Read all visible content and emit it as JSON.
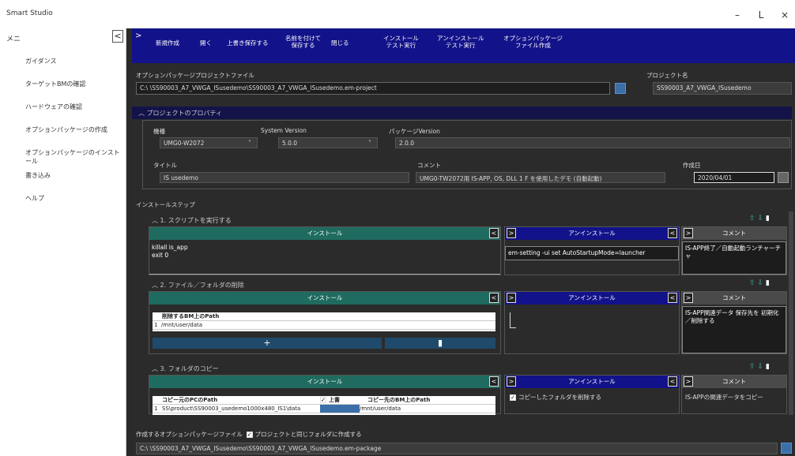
{
  "window": {
    "title": "Smart Studio",
    "minimize": "–",
    "maximize": "L",
    "close": "×"
  },
  "sidebar": {
    "menu_label": "メニ",
    "collapse": "<",
    "items": [
      "ガイダンス",
      "ターゲットBMの確認",
      "ハードウェアの確認",
      "オプションパッケージの作成",
      "オプションパッケージのインストール",
      "書き込み",
      "ヘルプ"
    ]
  },
  "toolbar": {
    "expand": ">",
    "buttons": [
      "新規作成",
      "開く",
      "上書き保存する",
      "名前を付けて\n保存する",
      "閉じる",
      "インストール\nテスト実行",
      "アンインストール\nテスト実行",
      "オプションパッケージ\nファイル作成"
    ]
  },
  "project": {
    "file_label": "オプションパッケージプロジェクトファイル",
    "file_path": "C:\\                                                              \\SS90003_A7_VWGA_ISusedemo\\SS90003_A7_VWGA_ISusedemo.em-project",
    "name_label": "プロジェクト名",
    "name_value": "SS90003_A7_VWGA_ISusedemo"
  },
  "properties": {
    "header": "プロジェクトのプロパティ",
    "model_label": "機種",
    "model_value": "UMG0-W2072",
    "sysver_label": "System Version",
    "sysver_value": "5.0.0",
    "pkgver_label": "パッケージVersion",
    "pkgver_value": "2.0.0",
    "title_label": "タイトル",
    "title_value": "IS usedemo",
    "comment_label": "コメント",
    "comment_value": "UMG0-TW2072用 IS-APP, OS, DLL 1 F を使用したデモ (自動起動)",
    "date_label": "作成日",
    "date_value": "2020/04/01"
  },
  "steps": {
    "header": "インストールステップ",
    "step1": {
      "title": "1. スクリプトを実行する",
      "install_hdr": "インストール",
      "uninstall_hdr": "アンインストール",
      "comment_hdr": "コメント",
      "install_text": "killall is_app\nexit 0",
      "uninstall_text": "em-setting -ui set AutoStartupMode=launcher",
      "comment_text": "IS-APP終了／自動起動ランチャーチャ"
    },
    "step2": {
      "title": "2. ファイル／フォルダの削除",
      "install_hdr": "インストール",
      "uninstall_hdr": "アンインストール",
      "comment_hdr": "コメント",
      "grid_header": "削除するBM上のPath",
      "grid_row_no": "1",
      "grid_row_value": "/mnt/user/data",
      "add": "+",
      "delete": "🗑",
      "comment_text": "IS-APP関連データ 保存先を 初期化／削除する"
    },
    "step3": {
      "title": "3. フォルダのコピー",
      "install_hdr": "インストール",
      "uninstall_hdr": "アンインストール",
      "comment_hdr": "コメント",
      "grid_src": "コピー元のPCのPath",
      "grid_check": "上書",
      "grid_dst": "コピー先のBM上のPath",
      "grid_row_no": "1",
      "grid_row_src": "SS\\product\\SS90003_usedemo1000x480_IS1\\data",
      "grid_row_dst": "/mnt/user/data",
      "uninstall_check": "コピーしたフォルダを削除する",
      "comment_text": "IS-APPの関連データをコピー"
    }
  },
  "output": {
    "label": "作成するオプションパッケージファイル",
    "same_folder": "プロジェクトと同じフォルダに作成する",
    "path": "C:\\                                                              \\SS90003_A7_VWGA_ISusedemo\\SS90003_A7_VWGA_ISusedemo.em-package"
  }
}
